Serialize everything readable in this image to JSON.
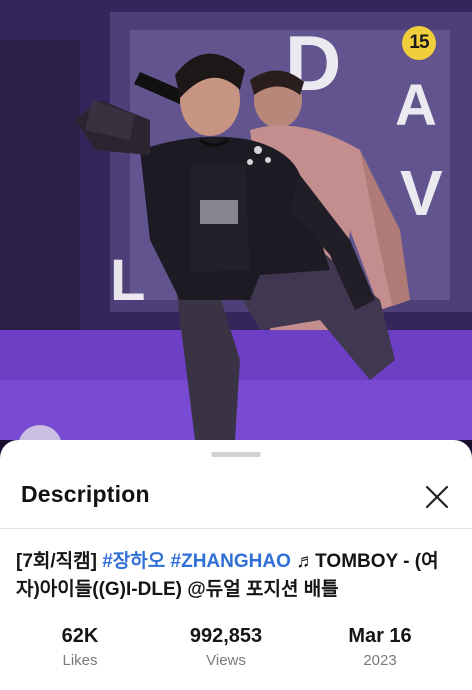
{
  "video": {
    "rating_badge": "15",
    "stage_letters": [
      "D",
      "A",
      "V",
      "L"
    ]
  },
  "sheet": {
    "title": "Description",
    "close_icon": "close-icon",
    "description": {
      "prefix": "[7회/직캠] ",
      "hashtag_1": "#장하오",
      "space": " ",
      "hashtag_2": "#ZHANGHAO",
      "music_symbol": " ♬",
      "song": "TOMBOY - (여자)아이들((G)I-DLE) @듀얼 포지션 배틀"
    },
    "stats": {
      "likes_value": "62K",
      "likes_label": "Likes",
      "views_value": "992,853",
      "views_label": "Views",
      "date_value": "Mar 16",
      "date_year": "2023"
    }
  },
  "colors": {
    "hashtag": "#2f6fd6",
    "badge": "#f1cf3c",
    "stage_purple": "#5b35a8"
  }
}
